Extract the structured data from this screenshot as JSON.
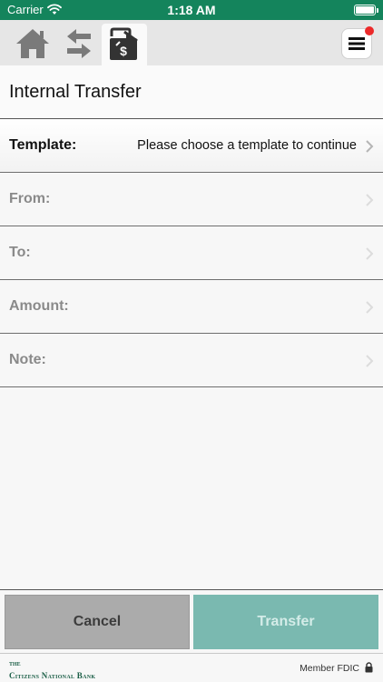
{
  "status_bar": {
    "carrier": "Carrier",
    "time": "1:18 AM"
  },
  "nav": {
    "items": [
      {
        "icon": "home-icon"
      },
      {
        "icon": "transfer-arrows-icon"
      },
      {
        "icon": "money-transfer-icon",
        "active": true
      }
    ],
    "menu_icon": "hamburger-menu-icon",
    "notification_color": "#ec2a2a"
  },
  "page": {
    "title": "Internal Transfer"
  },
  "form": {
    "template": {
      "label": "Template:",
      "value": "Please choose a template to continue"
    },
    "from": {
      "label": "From:"
    },
    "to": {
      "label": "To:"
    },
    "amount": {
      "label": "Amount:"
    },
    "note": {
      "label": "Note:"
    }
  },
  "buttons": {
    "cancel": "Cancel",
    "transfer": "Transfer"
  },
  "footer": {
    "logo_the": "THE",
    "logo_name": "Citizens National Bank",
    "member": "Member FDIC"
  },
  "colors": {
    "brand_green": "#14845c",
    "transfer_button": "#7ab9b0",
    "cancel_button": "#ababab"
  }
}
